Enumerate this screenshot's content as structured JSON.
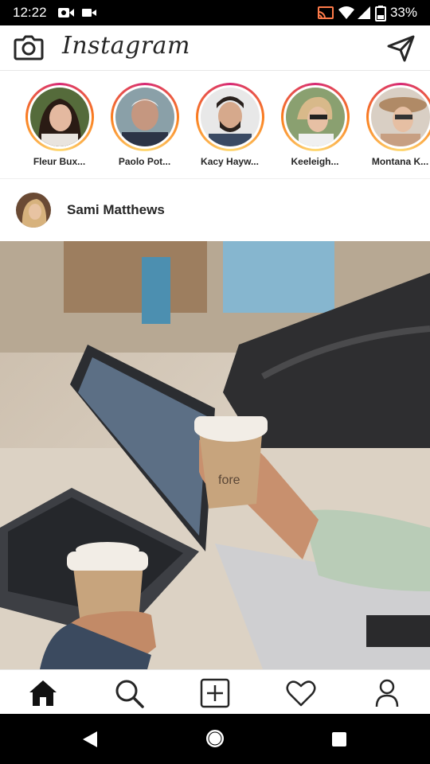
{
  "status_bar": {
    "time": "12:22",
    "battery": "33%",
    "icons": [
      "video-camera-icon",
      "video-icon",
      "cast-icon",
      "wifi-icon",
      "signal-icon",
      "battery-icon"
    ]
  },
  "app_bar": {
    "logo": "Instagram",
    "left_icon": "camera-icon",
    "right_icon": "direct-message-icon"
  },
  "stories": [
    {
      "name": "Fleur Bux...",
      "avatar_color": "#6b4a3a"
    },
    {
      "name": "Paolo Pot...",
      "avatar_color": "#8a7060"
    },
    {
      "name": "Kacy Hayw...",
      "avatar_color": "#3b3a3a"
    },
    {
      "name": "Keeleigh...",
      "avatar_color": "#c9a978"
    },
    {
      "name": "Montana K...",
      "avatar_color": "#a8806a"
    }
  ],
  "post": {
    "username": "Sami Matthews",
    "image_description_icon": "photo-icon",
    "cup_logo_text": "fore"
  },
  "bottom_nav": {
    "items": [
      "home-icon",
      "search-icon",
      "add-icon",
      "heart-icon",
      "profile-icon"
    ]
  },
  "system_nav": {
    "items": [
      "back-icon",
      "home-circle-icon",
      "recents-icon"
    ]
  },
  "colors": {
    "story_ring_start": "#d62976",
    "story_ring_end": "#fa7e1e",
    "text_primary": "#262626"
  }
}
